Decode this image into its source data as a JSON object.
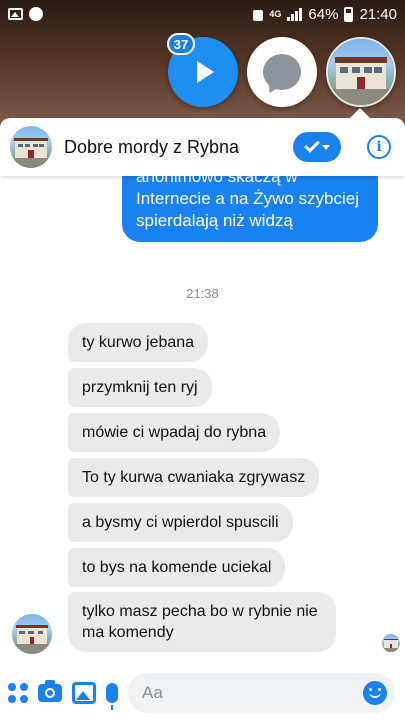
{
  "status_bar": {
    "battery": "64%",
    "time": "21:40",
    "network": "4G"
  },
  "chat_heads": {
    "badge_count": "37"
  },
  "conversation": {
    "title": "Dobre mordy z Rybna"
  },
  "messages": {
    "outgoing_last": "anonimowo skaczą w Internecie a na Żywo szybciej spierdalają niż widzą",
    "timestamp": "21:38",
    "incoming": [
      "ty kurwo jebana",
      "przymknij ten ryj",
      "mówie ci wpadaj do rybna",
      "To ty kurwa cwaniaka zgrywasz",
      "a bysmy ci wpierdol spuscili",
      "to bys na komende uciekal",
      "tylko masz pecha bo w rybnie nie ma komendy"
    ]
  },
  "composer": {
    "placeholder": "Aa"
  },
  "colors": {
    "accent": "#1a82f0",
    "incoming_bubble": "#eaeaea"
  }
}
